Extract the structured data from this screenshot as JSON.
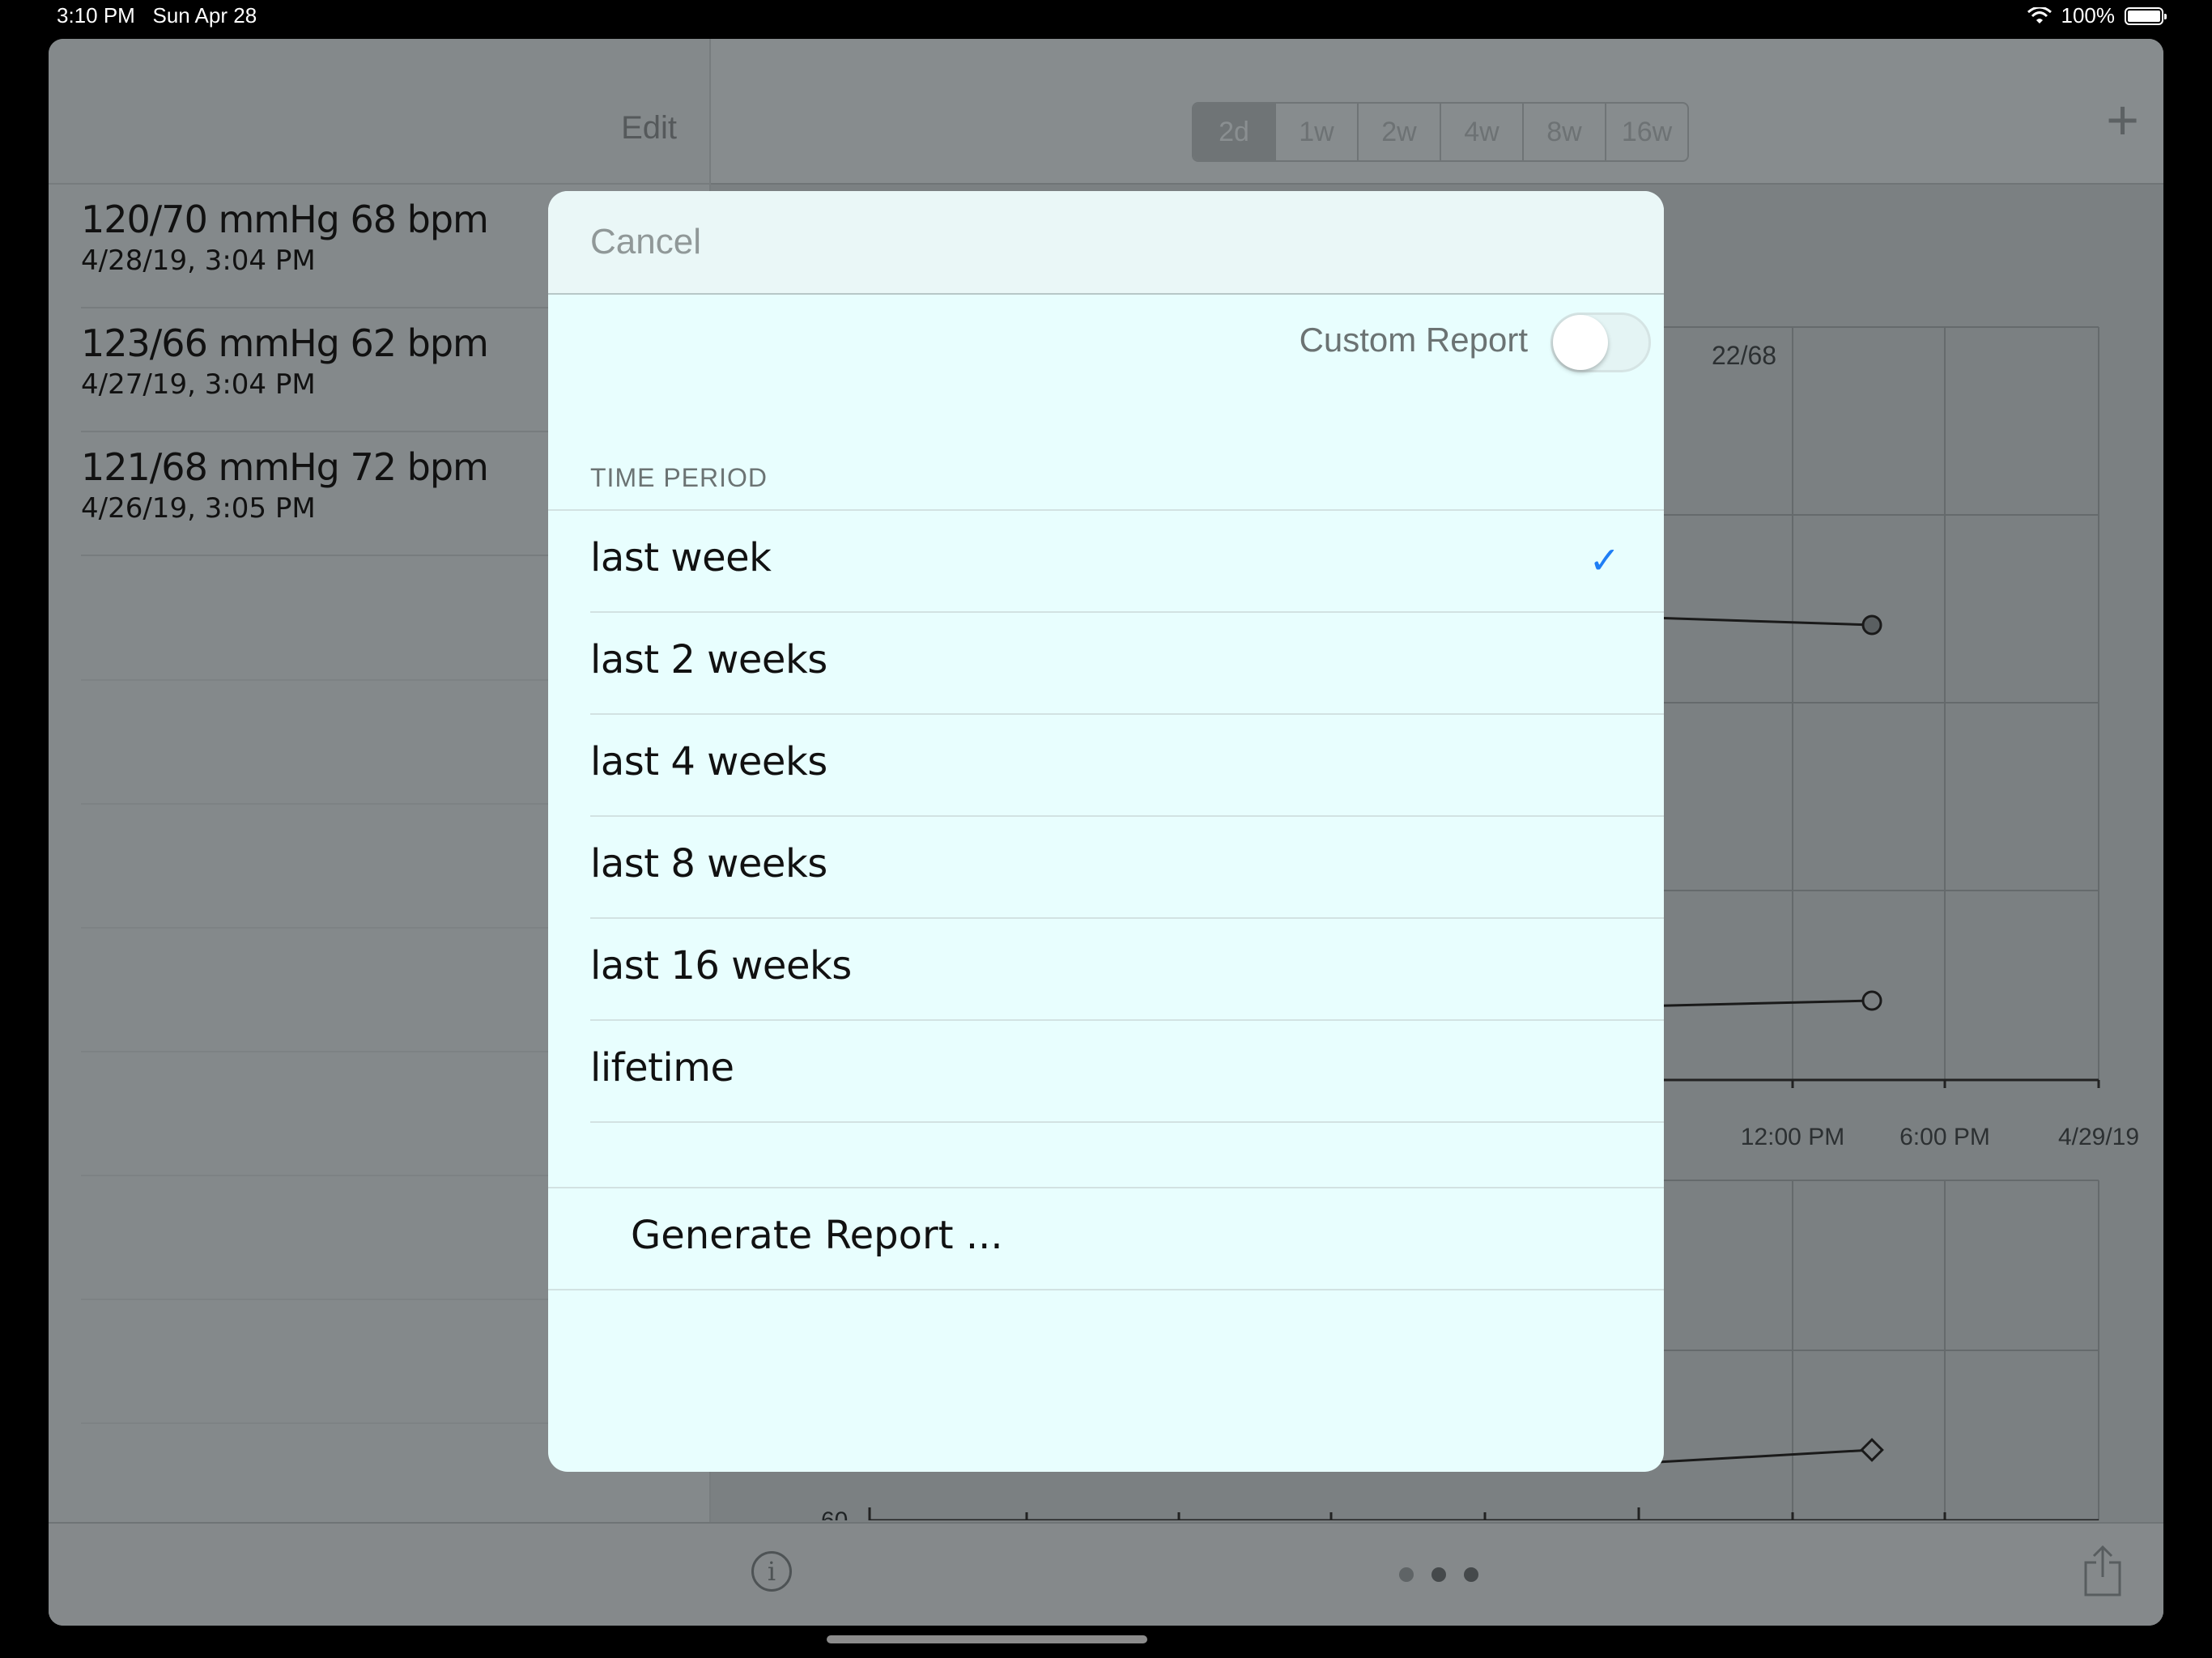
{
  "status_bar": {
    "time": "3:10 PM",
    "date": "Sun Apr 28",
    "battery": "100%"
  },
  "sidebar": {
    "edit_label": "Edit",
    "entries": [
      {
        "reading": "120/70 mmHg 68 bpm",
        "date": "4/28/19, 3:04 PM"
      },
      {
        "reading": "123/66 mmHg 62 bpm",
        "date": "4/27/19, 3:04 PM"
      },
      {
        "reading": "121/68 mmHg 72 bpm",
        "date": "4/26/19, 3:05 PM"
      }
    ]
  },
  "main": {
    "segments": [
      "2d",
      "1w",
      "2w",
      "4w",
      "8w",
      "16w"
    ],
    "selected_segment": "2d",
    "chart": {
      "top_label": "22/68",
      "x_ticks": [
        "12:00 PM",
        "6:00 PM",
        "4/29/19"
      ],
      "bottom_y_label": "60"
    },
    "page_dots": 3,
    "active_page": 2
  },
  "modal": {
    "cancel_label": "Cancel",
    "custom_report_label": "Custom Report",
    "custom_report_on": false,
    "section_title": "TIME PERIOD",
    "options": [
      {
        "label": "last week",
        "checked": true
      },
      {
        "label": "last 2 weeks",
        "checked": false
      },
      {
        "label": "last 4 weeks",
        "checked": false
      },
      {
        "label": "last 8 weeks",
        "checked": false
      },
      {
        "label": "last 16 weeks",
        "checked": false
      },
      {
        "label": "lifetime",
        "checked": false
      }
    ],
    "generate_label": "Generate Report ...",
    "check_glyph": "✓"
  },
  "colors": {
    "accent": "#1f7ef5",
    "modal_bg": "#e8fefe"
  }
}
